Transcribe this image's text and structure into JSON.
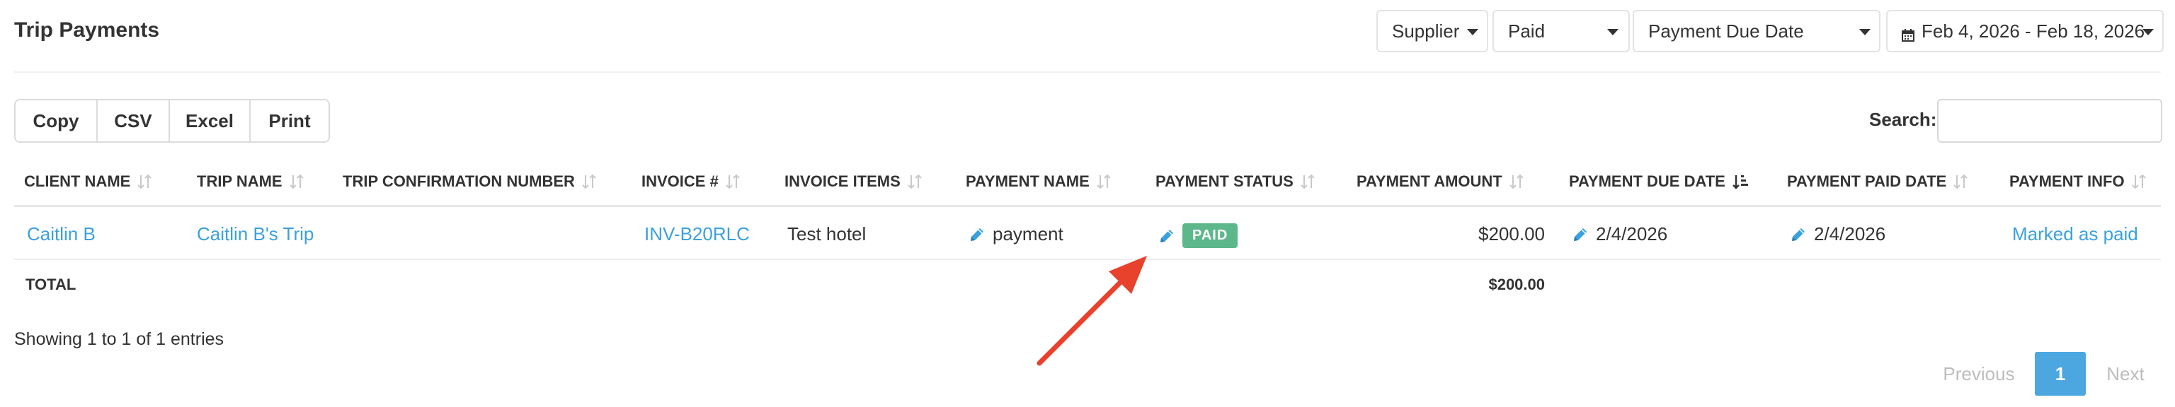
{
  "page": {
    "title": "Trip Payments"
  },
  "filters": {
    "supplier": "Supplier",
    "status": "Paid",
    "date_field": "Payment Due Date",
    "date_range": "Feb 4, 2026 - Feb 18, 2026"
  },
  "export_buttons": [
    "Copy",
    "CSV",
    "Excel",
    "Print"
  ],
  "search": {
    "label": "Search:",
    "value": ""
  },
  "table": {
    "columns": [
      "CLIENT NAME",
      "TRIP NAME",
      "TRIP CONFIRMATION NUMBER",
      "INVOICE #",
      "INVOICE ITEMS",
      "PAYMENT NAME",
      "PAYMENT STATUS",
      "PAYMENT AMOUNT",
      "PAYMENT DUE DATE",
      "PAYMENT PAID DATE",
      "PAYMENT INFO"
    ],
    "sorted_column": "PAYMENT DUE DATE",
    "rows": [
      {
        "client_name": "Caitlin B",
        "trip_name": "Caitlin B's Trip",
        "trip_confirmation_number": "",
        "invoice_number": "INV-B20RLC",
        "invoice_items": "Test hotel",
        "payment_name": "payment",
        "payment_status": "PAID",
        "payment_amount": "$200.00",
        "payment_due_date": "2/4/2026",
        "payment_paid_date": "2/4/2026",
        "payment_info": "Marked as paid"
      }
    ],
    "total_label": "TOTAL",
    "total_amount": "$200.00"
  },
  "info": "Showing 1 to 1 of 1 entries",
  "pagination": {
    "previous": "Previous",
    "current": "1",
    "next": "Next"
  },
  "colors": {
    "link": "#3ba1dd",
    "paid_badge": "#5cb88a",
    "page_active": "#4ca7e0",
    "annotation_arrow": "#e8412c"
  },
  "icons": [
    "caret-down-icon",
    "calendar-icon",
    "sort-icon",
    "sort-active-icon",
    "pencil-icon",
    "annotation-arrow"
  ]
}
